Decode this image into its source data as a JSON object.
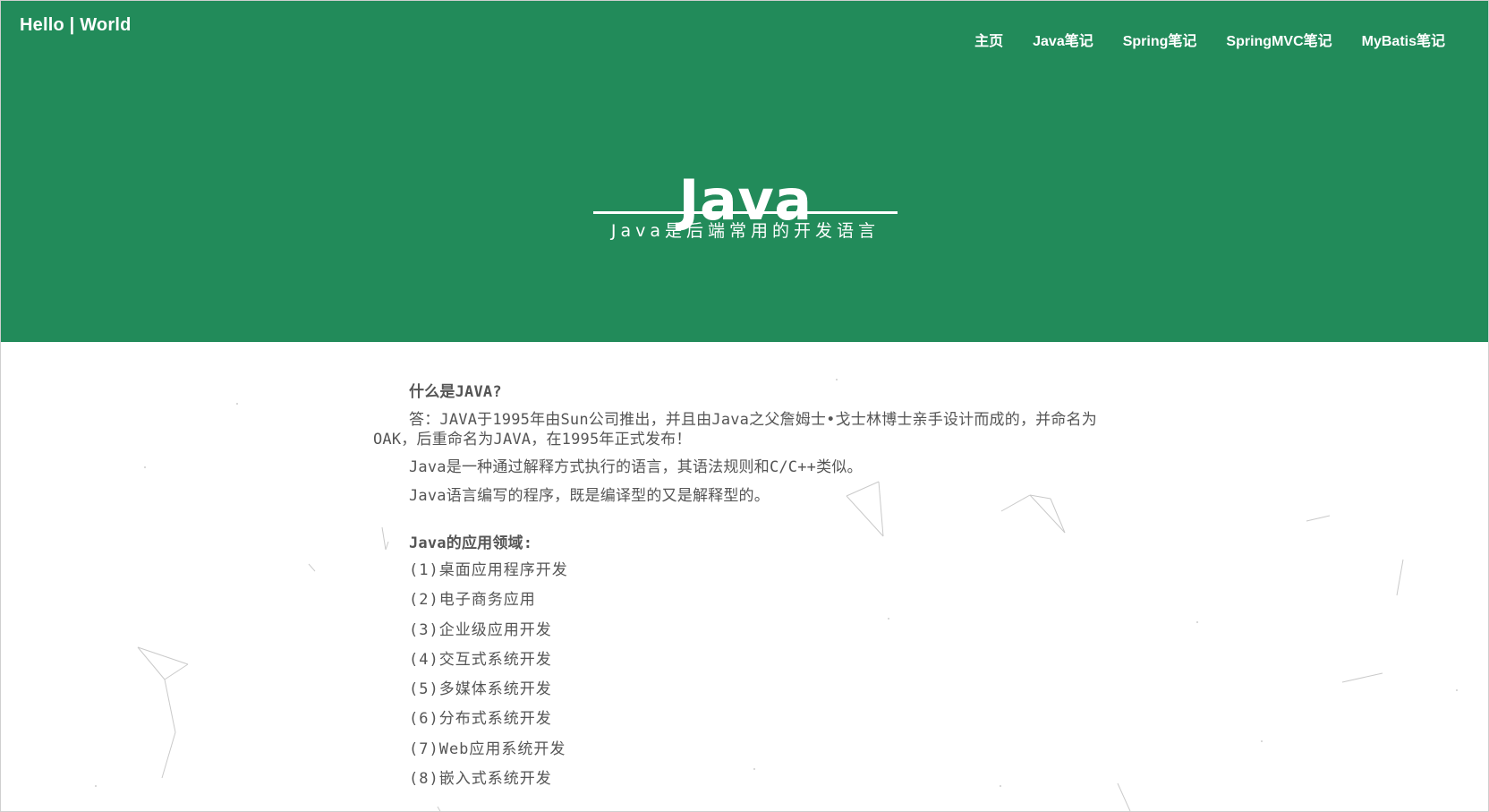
{
  "header": {
    "brand": "Hello | World",
    "nav": [
      {
        "label": "主页"
      },
      {
        "label": "Java笔记"
      },
      {
        "label": "Spring笔记"
      },
      {
        "label": "SpringMVC笔记"
      },
      {
        "label": "MyBatis笔记"
      }
    ],
    "title": "Java",
    "subtitle": "Java是后端常用的开发语言"
  },
  "article": {
    "section1": {
      "heading": "什么是JAVA?",
      "answer": "答：JAVA于1995年由Sun公司推出，并且由Java之父詹姆士•戈士林博士亲手设计而成的，并命名为OAK，后重命名为JAVA，在1995年正式发布！",
      "line2": "Java是一种通过解释方式执行的语言，其语法规则和C/C++类似。",
      "line3": "Java语言编写的程序，既是编译型的又是解释型的。"
    },
    "section2": {
      "heading": "Java的应用领域:",
      "items": [
        "(1)桌面应用程序开发",
        "(2)电子商务应用",
        "(3)企业级应用开发",
        "(4)交互式系统开发",
        "(5)多媒体系统开发",
        "(6)分布式系统开发",
        "(7)Web应用系统开发",
        "(8)嵌入式系统开发"
      ]
    }
  },
  "colors": {
    "hero_background": "#228b5a",
    "hero_text": "#ffffff",
    "body_text": "#555555"
  }
}
